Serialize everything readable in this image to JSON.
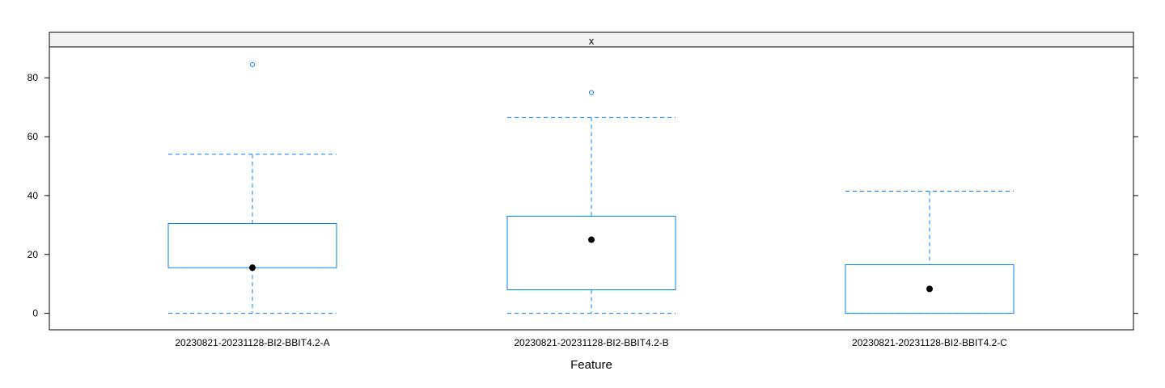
{
  "chart_data": {
    "type": "boxplot",
    "panel_label": "x",
    "xlabel": "Feature",
    "ylabel": "",
    "ylim": [
      -5.6,
      90.5
    ],
    "y_ticks": [
      0,
      20,
      40,
      60,
      80
    ],
    "grid": false,
    "legend": "none",
    "colors": {
      "box": "#0080ff",
      "median_dot": "#000000",
      "strip_fill": "#f2f2f2",
      "frame": "#000000"
    },
    "categories": [
      "20230821-20231128-BI2-BBIT4.2-A",
      "20230821-20231128-BI2-BBIT4.2-B",
      "20230821-20231128-BI2-BBIT4.2-C"
    ],
    "boxes": [
      {
        "category": "20230821-20231128-BI2-BBIT4.2-A",
        "whisker_low": 0,
        "q1": 15.5,
        "median": 15.5,
        "q3": 30.5,
        "whisker_high": 54,
        "outliers": [
          84.5
        ]
      },
      {
        "category": "20230821-20231128-BI2-BBIT4.2-B",
        "whisker_low": 0,
        "q1": 8,
        "median": 25,
        "q3": 33,
        "whisker_high": 66.5,
        "outliers": [
          75
        ]
      },
      {
        "category": "20230821-20231128-BI2-BBIT4.2-C",
        "whisker_low": 0,
        "q1": 0,
        "median": 8.3,
        "q3": 16.5,
        "whisker_high": 41.5,
        "outliers": []
      }
    ]
  }
}
